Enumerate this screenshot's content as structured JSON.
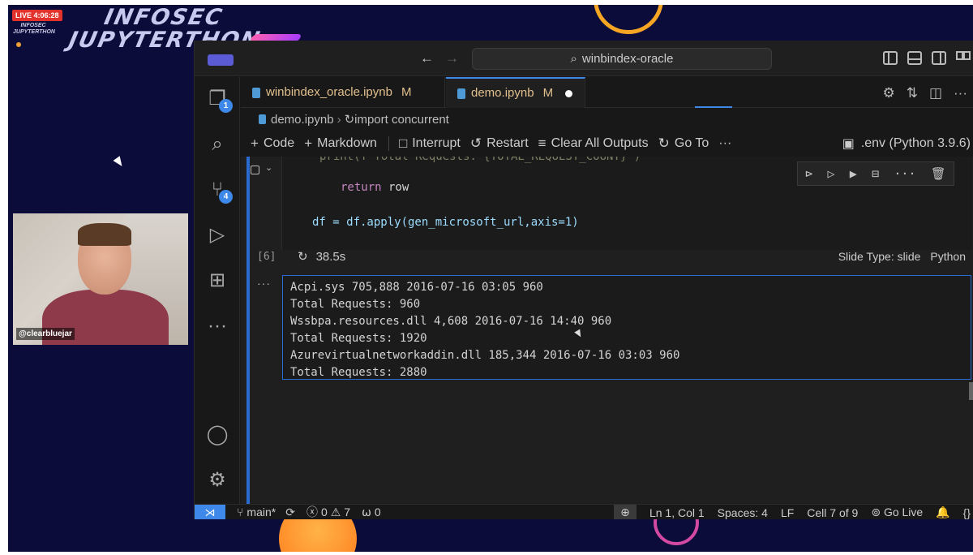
{
  "overlay": {
    "live_label": "LIVE 4:06:28",
    "mini_logo": "INFOSEC JUPYTERTHON",
    "brand_line1": "INFOSEC",
    "brand_line2": "JUPYTERTHON",
    "webcam_handle": "@clearbluejar"
  },
  "titlebar": {
    "search_text": "winbindex-oracle",
    "back_icon": "arrow-left-icon",
    "forward_icon": "arrow-right-icon"
  },
  "activity_bar": {
    "explorer_badge": "1",
    "scm_badge": "4"
  },
  "tabs": [
    {
      "label": "winbindex_oracle.ipynb",
      "modified": "M"
    },
    {
      "label": "demo.ipynb",
      "modified": "M"
    }
  ],
  "breadcrumb": {
    "file": "demo.ipynb",
    "symbol": "import concurrent"
  },
  "toolbar": {
    "code": "Code",
    "markdown": "Markdown",
    "interrupt": "Interrupt",
    "restart": "Restart",
    "clear_outputs": "Clear All Outputs",
    "go_to": "Go To",
    "more": "···",
    "kernel": ".env (Python 3.9.6)"
  },
  "cell": {
    "code_lines": [
      {
        "indent": "        ",
        "text": "print(f'Total Requests: {TOTAL_REQUEST_COUNT}')"
      },
      {
        "indent": "        ",
        "kw": "return",
        "rest": " row"
      },
      {
        "indent": "    ",
        "text": "df = df.apply(gen_microsoft_url,axis=1)"
      }
    ],
    "exec_count": "[6]",
    "exec_time": "38.5s",
    "slide_type": "Slide Type: slide",
    "language": "Python"
  },
  "output": {
    "lines": [
      "Acpi.sys 705,888 2016-07-16 03:05 960",
      "Total Requests: 960",
      "Wssbpa.resources.dll 4,608 2016-07-16 14:40 960",
      "Total Requests: 1920",
      "Azurevirtualnetworkaddin.dll 185,344 2016-07-16 03:03 960",
      "Total Requests: 2880"
    ]
  },
  "statusbar": {
    "branch": "main*",
    "errors": "0",
    "warnings": "7",
    "ports": "0",
    "position": "Ln 1, Col 1",
    "spaces": "Spaces: 4",
    "eol": "LF",
    "cell": "Cell 7 of 9",
    "go_live": "Go Live"
  },
  "colors": {
    "accent": "#3d88e8",
    "modified": "#e2c08d",
    "live": "#e3322b",
    "stream_bg": "#0b0c3a"
  }
}
